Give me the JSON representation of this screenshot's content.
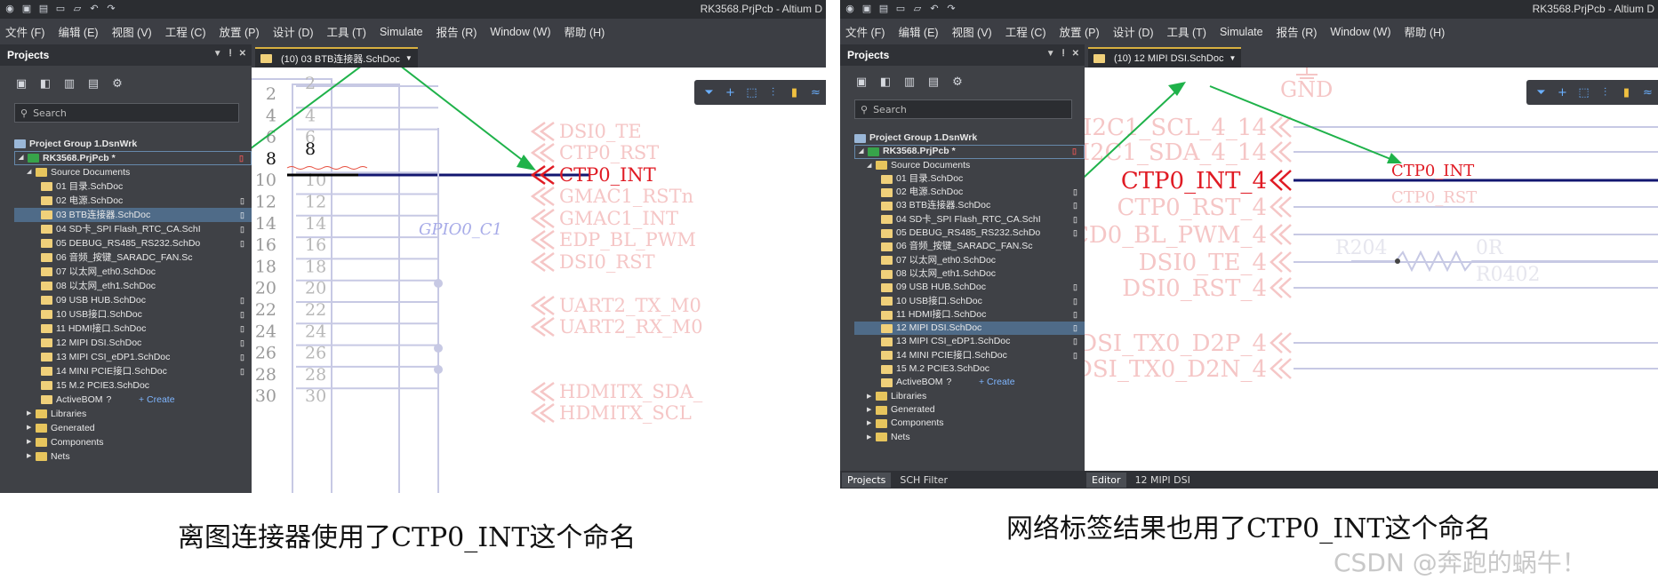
{
  "left": {
    "title": "RK3568.PrjPcb - Altium D",
    "menu": [
      "文件 (F)",
      "编辑 (E)",
      "视图 (V)",
      "工程 (C)",
      "放置 (P)",
      "设计 (D)",
      "工具 (T)",
      "Simulate",
      "报告 (R)",
      "Window (W)",
      "帮助 (H)"
    ],
    "panel_title": "Projects",
    "search_placeholder": "Search",
    "doc_tab": "(10) 03 BTB连接器.SchDoc",
    "tree": {
      "group": "Project Group 1.DsnWrk",
      "project": "RK3568.PrjPcb *",
      "source": "Source Documents",
      "files": [
        "01 目录.SchDoc",
        "02 电源.SchDoc",
        "03 BTB连接器.SchDoc",
        "04 SD卡_SPI Flash_RTC_CA.SchI",
        "05 DEBUG_RS485_RS232.SchDo",
        "06 音频_按键_SARADC_FAN.Sc",
        "07 以太网_eth0.SchDoc",
        "08 以太网_eth1.SchDoc",
        "09 USB HUB.SchDoc",
        "10 USB接口.SchDoc",
        "11 HDMI接口.SchDoc",
        "12 MIPI DSI.SchDoc",
        "13 MIPI CSI_eDP1.SchDoc",
        "14 MINI PCIE接口.SchDoc",
        "15 M.2 PCIE3.SchDoc"
      ],
      "activebom": "ActiveBOM",
      "create": "+ Create",
      "folders": [
        "Libraries",
        "Generated",
        "Components",
        "Nets"
      ]
    },
    "pin_numbers_left": [
      "2",
      "4",
      "6",
      "8",
      "10",
      "12",
      "14",
      "16",
      "18",
      "20",
      "22",
      "24",
      "26",
      "28",
      "30"
    ],
    "pin_numbers_inner": [
      "2",
      "4",
      "6",
      "8",
      "10",
      "12",
      "14",
      "16",
      "18",
      "20",
      "22",
      "24",
      "26",
      "28",
      "30"
    ],
    "net_labels": [
      "DSI0_TE",
      "CTP0_RST",
      "CTP0_INT",
      "GMAC1_RSTn",
      "GMAC1_INT",
      "EDP_BL_PWM",
      "DSI0_RST",
      "UART2_TX_M0",
      "UART2_RX_M0",
      "HDMITX_SDA_",
      "HDMITX_SCL"
    ],
    "gpio_label": "GPIO0_C1",
    "caption": "离图连接器使用了CTP0_INT这个命名"
  },
  "right": {
    "title": "RK3568.PrjPcb - Altium D",
    "menu": [
      "文件 (F)",
      "编辑 (E)",
      "视图 (V)",
      "工程 (C)",
      "放置 (P)",
      "设计 (D)",
      "工具 (T)",
      "Simulate",
      "报告 (R)",
      "Window (W)",
      "帮助 (H)"
    ],
    "panel_title": "Projects",
    "search_placeholder": "Search",
    "doc_tab": "(10) 12 MIPI DSI.SchDoc",
    "tree": {
      "group": "Project Group 1.DsnWrk",
      "project": "RK3568.PrjPcb *",
      "source": "Source Documents",
      "files": [
        "01 目录.SchDoc",
        "02 电源.SchDoc",
        "03 BTB连接器.SchDoc",
        "04 SD卡_SPI Flash_RTC_CA.SchI",
        "05 DEBUG_RS485_RS232.SchDo",
        "06 音频_按键_SARADC_FAN.Sc",
        "07 以太网_eth0.SchDoc",
        "08 以太网_eth1.SchDoc",
        "09 USB HUB.SchDoc",
        "10 USB接口.SchDoc",
        "11 HDMI接口.SchDoc",
        "12 MIPI DSI.SchDoc",
        "13 MIPI CSI_eDP1.SchDoc",
        "14 MINI PCIE接口.SchDoc",
        "15 M.2 PCIE3.SchDoc"
      ],
      "activebom": "ActiveBOM",
      "create": "+ Create",
      "folders": [
        "Libraries",
        "Generated",
        "Components",
        "Nets"
      ]
    },
    "bottom_tabs": [
      "Projects",
      "SCH Filter"
    ],
    "editor_tabs": [
      "Editor",
      "12 MIPI DSI"
    ],
    "gnd": "GND",
    "port_labels": [
      "I2C1_SCL_4_14",
      "I2C1_SDA_4_14",
      "CTP0_INT_4",
      "CTP0_RST_4",
      "CD0_BL_PWM_4",
      "DSI0_TE_4",
      "DSI0_RST_4",
      "DSI_TX0_D2P_4",
      "DSI_TX0_D2N_4"
    ],
    "net_label": "CTP0_INT",
    "net_label_faded": "CTP0_RST",
    "resistor": {
      "ref": "R204",
      "value": "0R",
      "package": "R0402"
    },
    "caption": "网络标签结果也用了CTP0_INT这个命名"
  },
  "watermark": "CSDN @奔跑的蜗牛！"
}
